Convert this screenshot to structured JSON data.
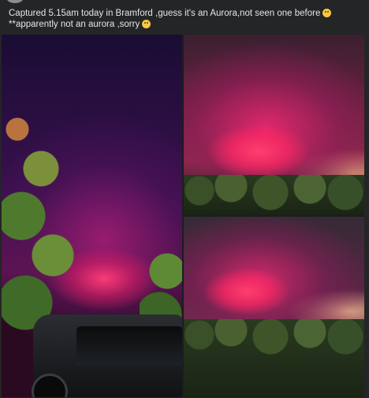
{
  "post": {
    "caption_line1": "Captured 5.15am today in Bramford ,guess it's an Aurora,not seen one before",
    "caption_emoji1": "smiling-face-with-hearts",
    "caption_line2": "**apparently not an aurora ,sorry",
    "caption_emoji2": "crying-face"
  },
  "gallery": {
    "photo_count": 3
  }
}
